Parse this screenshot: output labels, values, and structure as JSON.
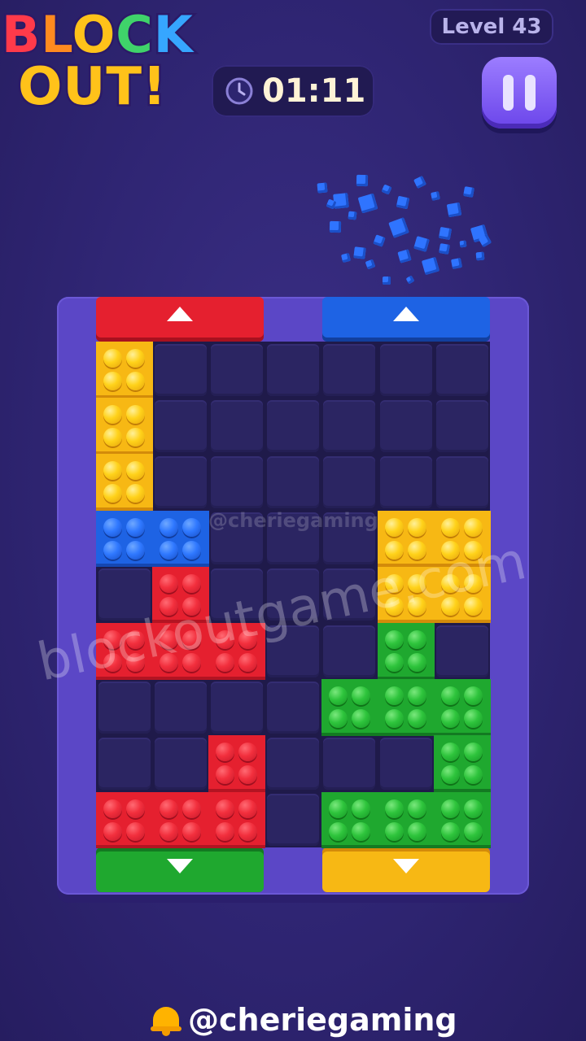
{
  "logo": {
    "line1": "BLOCK",
    "line2": "OUT!"
  },
  "level": {
    "label": "Level 43"
  },
  "timer": {
    "value": "01:11",
    "icon": "clock-icon"
  },
  "pause": {
    "icon": "pause-icon"
  },
  "board": {
    "columns": 7,
    "rows": 9,
    "gates": [
      {
        "side": "top",
        "color": "#e5202f",
        "direction": "up"
      },
      {
        "side": "top",
        "color": "#1e63e4",
        "direction": "up"
      },
      {
        "side": "bottom",
        "color": "#1fa82f",
        "direction": "down"
      },
      {
        "side": "bottom",
        "color": "#f7b814",
        "direction": "down"
      }
    ],
    "pieces": [
      {
        "color": "yellow",
        "shape": "vertical-1x3"
      },
      {
        "color": "blue",
        "shape": "horizontal-2x1"
      },
      {
        "color": "yellow",
        "shape": "square-2x2"
      },
      {
        "color": "red",
        "shape": "T"
      },
      {
        "color": "green",
        "shape": "T"
      },
      {
        "color": "red",
        "shape": "J"
      },
      {
        "color": "green",
        "shape": "J"
      }
    ]
  },
  "watermark": {
    "text": "blockoutgame.com",
    "faint": "@cheriegaming"
  },
  "footer": {
    "handle": "@cheriegaming",
    "icon": "bell-icon"
  },
  "colors": {
    "red": "#e5202f",
    "yellow": "#f7b814",
    "blue": "#1e63e4",
    "green": "#1fa82f",
    "frame": "#5b47c6",
    "background": "#2f2573"
  }
}
